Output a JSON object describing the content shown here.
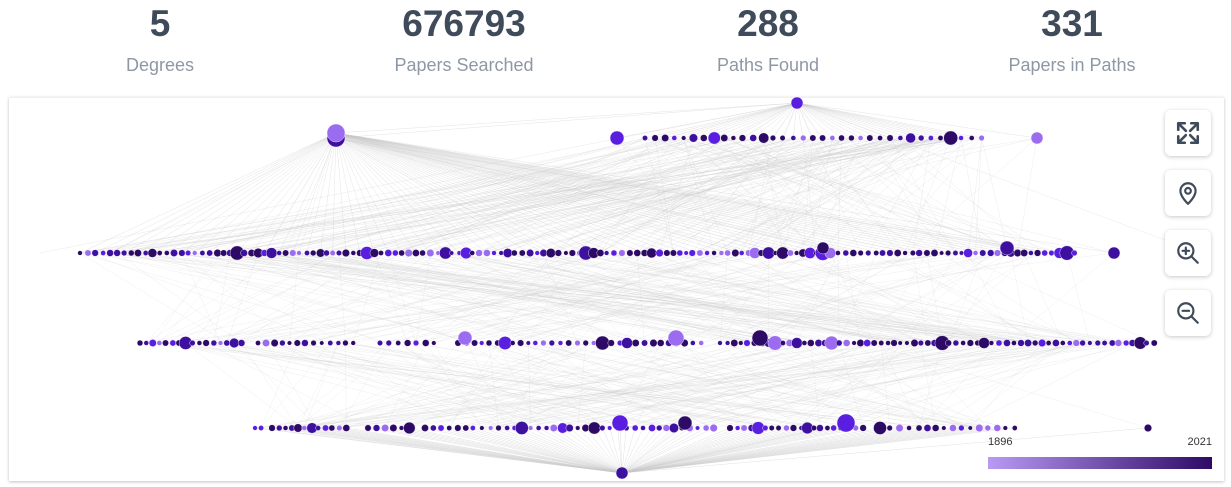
{
  "stats": [
    {
      "value": "5",
      "label": "Degrees"
    },
    {
      "value": "676793",
      "label": "Papers Searched"
    },
    {
      "value": "288",
      "label": "Paths Found"
    },
    {
      "value": "331",
      "label": "Papers in Paths"
    }
  ],
  "controls": [
    {
      "name": "fullscreen-button",
      "icon": "expand-arrows-icon"
    },
    {
      "name": "locate-button",
      "icon": "map-pin-icon"
    },
    {
      "name": "zoom-in-button",
      "icon": "zoom-in-icon"
    },
    {
      "name": "zoom-out-button",
      "icon": "zoom-out-icon"
    }
  ],
  "color_scale": {
    "min_label": "1896",
    "max_label": "2021",
    "min_color": "#b99af2",
    "max_color": "#2d0a66"
  },
  "colors": {
    "node_dark": "#2d0a66",
    "node_mid": "#3d10a0",
    "node_bright": "#5a1ee0",
    "node_light": "#9b6cf0",
    "edge": "#c9c9c9"
  }
}
